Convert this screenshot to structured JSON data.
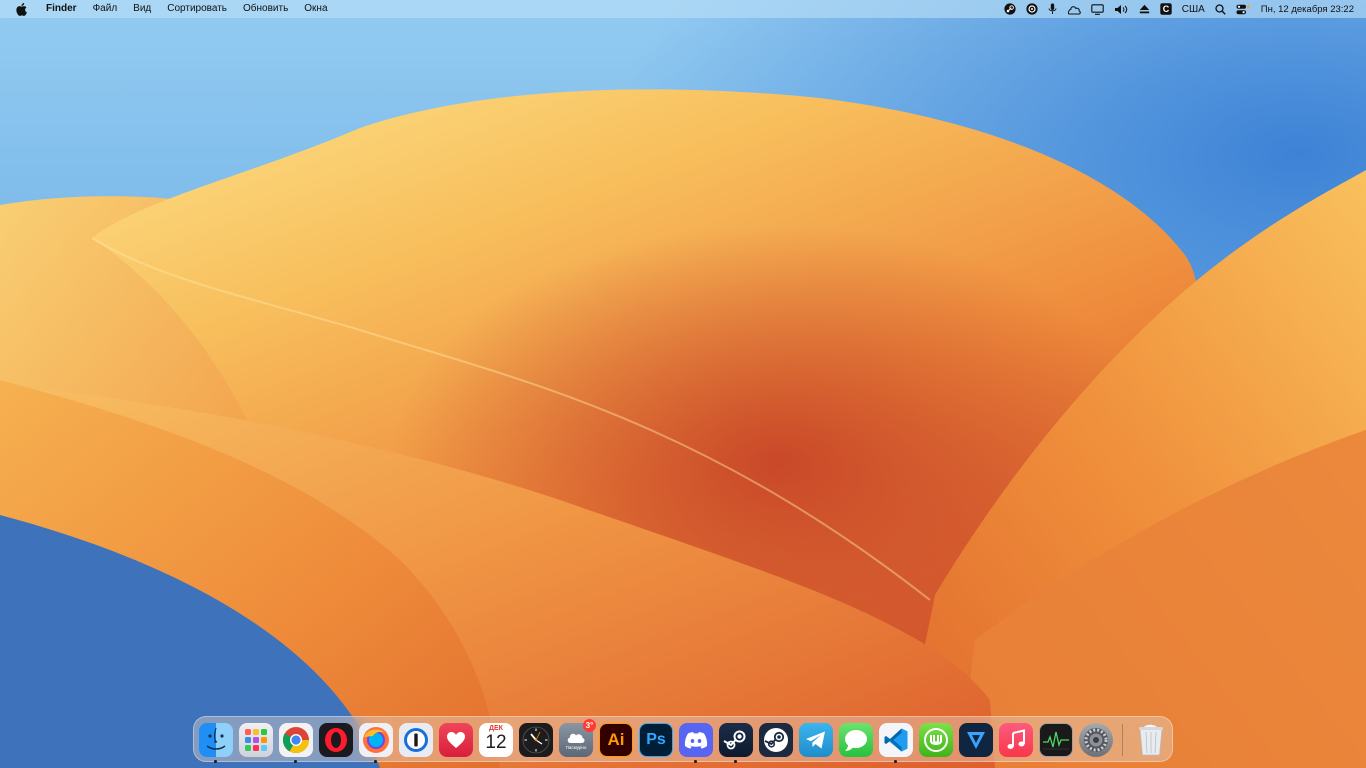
{
  "menubar": {
    "app_name": "Finder",
    "items": [
      "Файл",
      "Вид",
      "Сортировать",
      "Обновить",
      "Окна"
    ],
    "status_icons": [
      "steam-icon",
      "chatgpt-icon",
      "microphone-icon",
      "cloud-drive-icon",
      "display-icon",
      "volume-icon",
      "eject-icon",
      "keyboard-layout-icon",
      "search-icon",
      "control-center-icon"
    ],
    "input_source": "США",
    "datetime": "Пн, 12 декабря 23:22"
  },
  "dock": {
    "apps": [
      {
        "name": "Finder",
        "icon": "finder-icon",
        "running": true
      },
      {
        "name": "Launchpad",
        "icon": "launchpad-icon",
        "running": false
      },
      {
        "name": "Google Chrome",
        "icon": "chrome-icon",
        "running": true
      },
      {
        "name": "Opera",
        "icon": "opera-icon",
        "running": false
      },
      {
        "name": "Firefox",
        "icon": "firefox-icon",
        "running": true
      },
      {
        "name": "1Password",
        "icon": "1password-icon",
        "running": false
      },
      {
        "name": "Health",
        "icon": "heart-icon",
        "running": false
      },
      {
        "name": "Календарь",
        "icon": "calendar-icon",
        "running": false
      },
      {
        "name": "Часы",
        "icon": "clock-icon",
        "running": false
      },
      {
        "name": "Погода",
        "icon": "weather-icon",
        "running": false
      },
      {
        "name": "Illustrator",
        "icon": "illustrator-icon",
        "running": false
      },
      {
        "name": "Photoshop",
        "icon": "photoshop-icon",
        "running": false
      },
      {
        "name": "Discord",
        "icon": "discord-icon",
        "running": true
      },
      {
        "name": "Steam",
        "icon": "steam-icon",
        "running": true
      },
      {
        "name": "Steam Link",
        "icon": "steam-link-icon",
        "running": false
      },
      {
        "name": "Telegram",
        "icon": "telegram-icon",
        "running": false
      },
      {
        "name": "Messages",
        "icon": "messages-icon",
        "running": false
      },
      {
        "name": "Visual Studio Code",
        "icon": "vscode-icon",
        "running": true
      },
      {
        "name": "uTorrent",
        "icon": "utorrent-icon",
        "running": false
      },
      {
        "name": "Surfshark VPN",
        "icon": "vpn-icon",
        "running": false
      },
      {
        "name": "Music",
        "icon": "music-icon",
        "running": false
      },
      {
        "name": "Activity Monitor",
        "icon": "activity-monitor-icon",
        "running": false
      },
      {
        "name": "System Settings",
        "icon": "settings-icon",
        "running": false
      }
    ],
    "calendar": {
      "month": "ДЕК",
      "day": "12"
    },
    "weather": {
      "badge": "3°",
      "label": "Пасмурно"
    },
    "illustrator_label": "Ai",
    "photoshop_label": "Ps",
    "trash": {
      "name": "Корзина",
      "icon": "trash-icon"
    }
  },
  "colors": {
    "sky_top": "#8ec6ee",
    "sky_blue": "#4a8fd8",
    "wave_light": "#fbd77a",
    "wave_orange": "#f0913d",
    "wave_deep": "#c8432a"
  }
}
